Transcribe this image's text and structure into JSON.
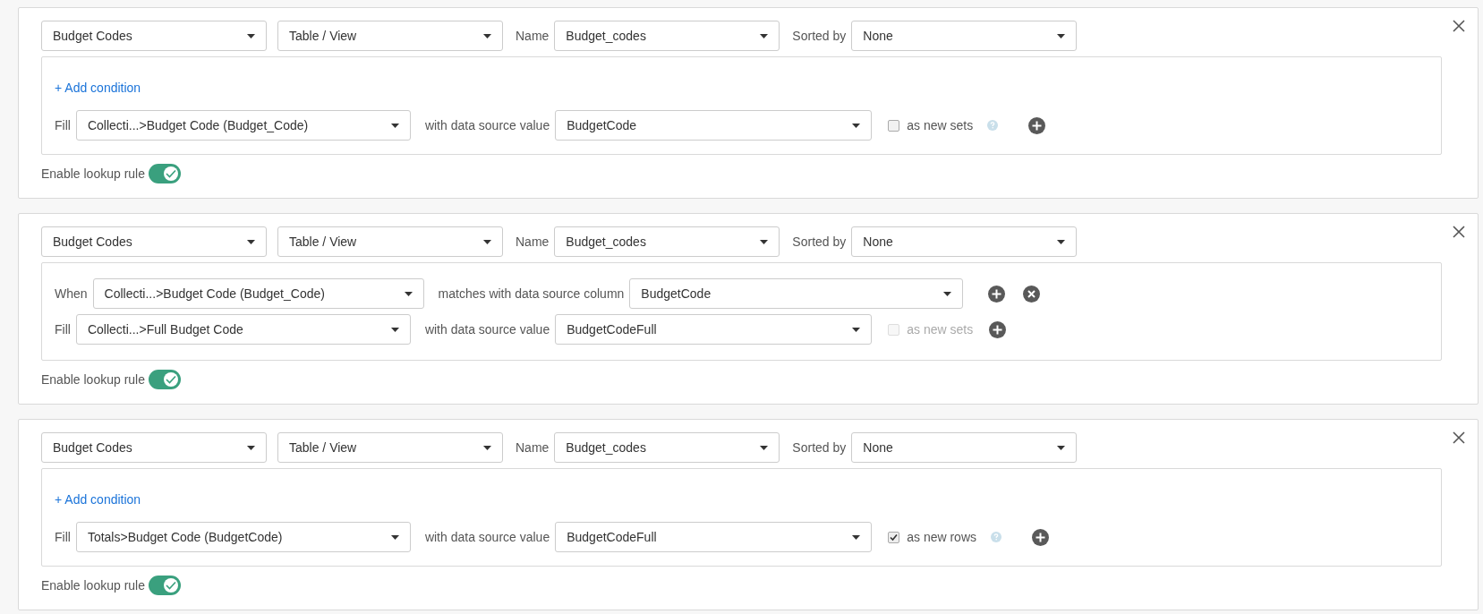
{
  "rules": [
    {
      "source": "Budget Codes",
      "type": "Table / View",
      "name_label": "Name",
      "name": "Budget_codes",
      "sorted_label": "Sorted by",
      "sorted": "None",
      "add_condition": "+ Add condition",
      "fill": {
        "label": "Fill",
        "field": "Collecti...>Budget Code (Budget_Code)",
        "value_label": "with data source value",
        "value": "BudgetCode",
        "option": {
          "label": "as new sets",
          "checked": false,
          "disabled": false,
          "help": true
        }
      },
      "toggle": {
        "label": "Enable lookup rule",
        "on": true
      }
    },
    {
      "source": "Budget Codes",
      "type": "Table / View",
      "name_label": "Name",
      "name": "Budget_codes",
      "sorted_label": "Sorted by",
      "sorted": "None",
      "conditions": [
        {
          "label": "When",
          "field": "Collecti...>Budget Code (Budget_Code)",
          "match_label": "matches with data source column",
          "column": "BudgetCode"
        }
      ],
      "fill": {
        "label": "Fill",
        "field": "Collecti...>Full Budget Code",
        "value_label": "with data source value",
        "value": "BudgetCodeFull",
        "option": {
          "label": "as new sets",
          "checked": false,
          "disabled": true,
          "help": false
        }
      },
      "toggle": {
        "label": "Enable lookup rule",
        "on": true
      }
    },
    {
      "source": "Budget Codes",
      "type": "Table / View",
      "name_label": "Name",
      "name": "Budget_codes",
      "sorted_label": "Sorted by",
      "sorted": "None",
      "add_condition": "+ Add condition",
      "fill": {
        "label": "Fill",
        "field": "Totals>Budget Code (BudgetCode)",
        "value_label": "with data source value",
        "value": "BudgetCodeFull",
        "option": {
          "label": "as new rows",
          "checked": true,
          "disabled": false,
          "help": true
        }
      },
      "toggle": {
        "label": "Enable lookup rule",
        "on": true
      }
    }
  ]
}
